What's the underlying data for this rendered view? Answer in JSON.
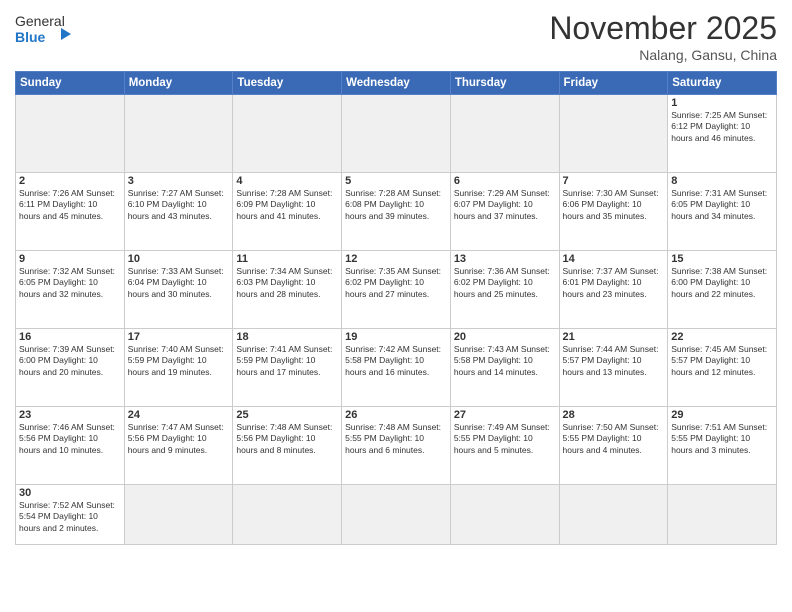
{
  "logo": {
    "text_general": "General",
    "text_blue": "Blue"
  },
  "header": {
    "month_title": "November 2025",
    "location": "Nalang, Gansu, China"
  },
  "weekdays": [
    "Sunday",
    "Monday",
    "Tuesday",
    "Wednesday",
    "Thursday",
    "Friday",
    "Saturday"
  ],
  "weeks": [
    [
      {
        "day": "",
        "empty": true
      },
      {
        "day": "",
        "empty": true
      },
      {
        "day": "",
        "empty": true
      },
      {
        "day": "",
        "empty": true
      },
      {
        "day": "",
        "empty": true
      },
      {
        "day": "",
        "empty": true
      },
      {
        "day": "1",
        "info": "Sunrise: 7:25 AM\nSunset: 6:12 PM\nDaylight: 10 hours\nand 46 minutes."
      }
    ],
    [
      {
        "day": "2",
        "info": "Sunrise: 7:26 AM\nSunset: 6:11 PM\nDaylight: 10 hours\nand 45 minutes."
      },
      {
        "day": "3",
        "info": "Sunrise: 7:27 AM\nSunset: 6:10 PM\nDaylight: 10 hours\nand 43 minutes."
      },
      {
        "day": "4",
        "info": "Sunrise: 7:28 AM\nSunset: 6:09 PM\nDaylight: 10 hours\nand 41 minutes."
      },
      {
        "day": "5",
        "info": "Sunrise: 7:28 AM\nSunset: 6:08 PM\nDaylight: 10 hours\nand 39 minutes."
      },
      {
        "day": "6",
        "info": "Sunrise: 7:29 AM\nSunset: 6:07 PM\nDaylight: 10 hours\nand 37 minutes."
      },
      {
        "day": "7",
        "info": "Sunrise: 7:30 AM\nSunset: 6:06 PM\nDaylight: 10 hours\nand 35 minutes."
      },
      {
        "day": "8",
        "info": "Sunrise: 7:31 AM\nSunset: 6:05 PM\nDaylight: 10 hours\nand 34 minutes."
      }
    ],
    [
      {
        "day": "9",
        "info": "Sunrise: 7:32 AM\nSunset: 6:05 PM\nDaylight: 10 hours\nand 32 minutes."
      },
      {
        "day": "10",
        "info": "Sunrise: 7:33 AM\nSunset: 6:04 PM\nDaylight: 10 hours\nand 30 minutes."
      },
      {
        "day": "11",
        "info": "Sunrise: 7:34 AM\nSunset: 6:03 PM\nDaylight: 10 hours\nand 28 minutes."
      },
      {
        "day": "12",
        "info": "Sunrise: 7:35 AM\nSunset: 6:02 PM\nDaylight: 10 hours\nand 27 minutes."
      },
      {
        "day": "13",
        "info": "Sunrise: 7:36 AM\nSunset: 6:02 PM\nDaylight: 10 hours\nand 25 minutes."
      },
      {
        "day": "14",
        "info": "Sunrise: 7:37 AM\nSunset: 6:01 PM\nDaylight: 10 hours\nand 23 minutes."
      },
      {
        "day": "15",
        "info": "Sunrise: 7:38 AM\nSunset: 6:00 PM\nDaylight: 10 hours\nand 22 minutes."
      }
    ],
    [
      {
        "day": "16",
        "info": "Sunrise: 7:39 AM\nSunset: 6:00 PM\nDaylight: 10 hours\nand 20 minutes."
      },
      {
        "day": "17",
        "info": "Sunrise: 7:40 AM\nSunset: 5:59 PM\nDaylight: 10 hours\nand 19 minutes."
      },
      {
        "day": "18",
        "info": "Sunrise: 7:41 AM\nSunset: 5:59 PM\nDaylight: 10 hours\nand 17 minutes."
      },
      {
        "day": "19",
        "info": "Sunrise: 7:42 AM\nSunset: 5:58 PM\nDaylight: 10 hours\nand 16 minutes."
      },
      {
        "day": "20",
        "info": "Sunrise: 7:43 AM\nSunset: 5:58 PM\nDaylight: 10 hours\nand 14 minutes."
      },
      {
        "day": "21",
        "info": "Sunrise: 7:44 AM\nSunset: 5:57 PM\nDaylight: 10 hours\nand 13 minutes."
      },
      {
        "day": "22",
        "info": "Sunrise: 7:45 AM\nSunset: 5:57 PM\nDaylight: 10 hours\nand 12 minutes."
      }
    ],
    [
      {
        "day": "23",
        "info": "Sunrise: 7:46 AM\nSunset: 5:56 PM\nDaylight: 10 hours\nand 10 minutes."
      },
      {
        "day": "24",
        "info": "Sunrise: 7:47 AM\nSunset: 5:56 PM\nDaylight: 10 hours\nand 9 minutes."
      },
      {
        "day": "25",
        "info": "Sunrise: 7:48 AM\nSunset: 5:56 PM\nDaylight: 10 hours\nand 8 minutes."
      },
      {
        "day": "26",
        "info": "Sunrise: 7:48 AM\nSunset: 5:55 PM\nDaylight: 10 hours\nand 6 minutes."
      },
      {
        "day": "27",
        "info": "Sunrise: 7:49 AM\nSunset: 5:55 PM\nDaylight: 10 hours\nand 5 minutes."
      },
      {
        "day": "28",
        "info": "Sunrise: 7:50 AM\nSunset: 5:55 PM\nDaylight: 10 hours\nand 4 minutes."
      },
      {
        "day": "29",
        "info": "Sunrise: 7:51 AM\nSunset: 5:55 PM\nDaylight: 10 hours\nand 3 minutes."
      }
    ],
    [
      {
        "day": "30",
        "info": "Sunrise: 7:52 AM\nSunset: 5:54 PM\nDaylight: 10 hours\nand 2 minutes."
      },
      {
        "day": "",
        "empty": true
      },
      {
        "day": "",
        "empty": true
      },
      {
        "day": "",
        "empty": true
      },
      {
        "day": "",
        "empty": true
      },
      {
        "day": "",
        "empty": true
      },
      {
        "day": "",
        "empty": true
      }
    ]
  ]
}
